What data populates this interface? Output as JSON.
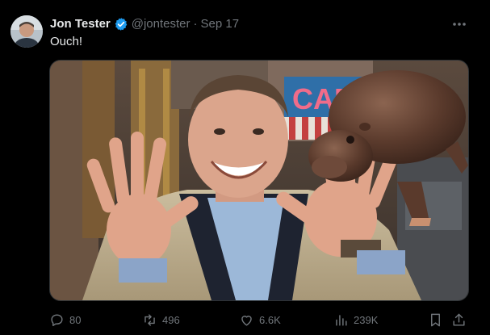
{
  "author": {
    "name": "Jon Tester",
    "handle": "@jontester",
    "separator": "·",
    "date": "Sep 17",
    "verified": true
  },
  "post": {
    "text": "Ouch!",
    "media_text": "CAF"
  },
  "actions": {
    "replies": "80",
    "reposts": "496",
    "likes": "6.6K",
    "views": "239K"
  },
  "icons": {
    "verified": "verified-badge-icon",
    "more": "more-icon",
    "reply": "reply-icon",
    "repost": "repost-icon",
    "like": "like-icon",
    "views": "views-icon",
    "bookmark": "bookmark-icon",
    "share": "share-icon"
  },
  "colors": {
    "background": "#000000",
    "text_primary": "#e7e9ea",
    "text_secondary": "#71767b",
    "verified_blue": "#1d9bf0"
  }
}
